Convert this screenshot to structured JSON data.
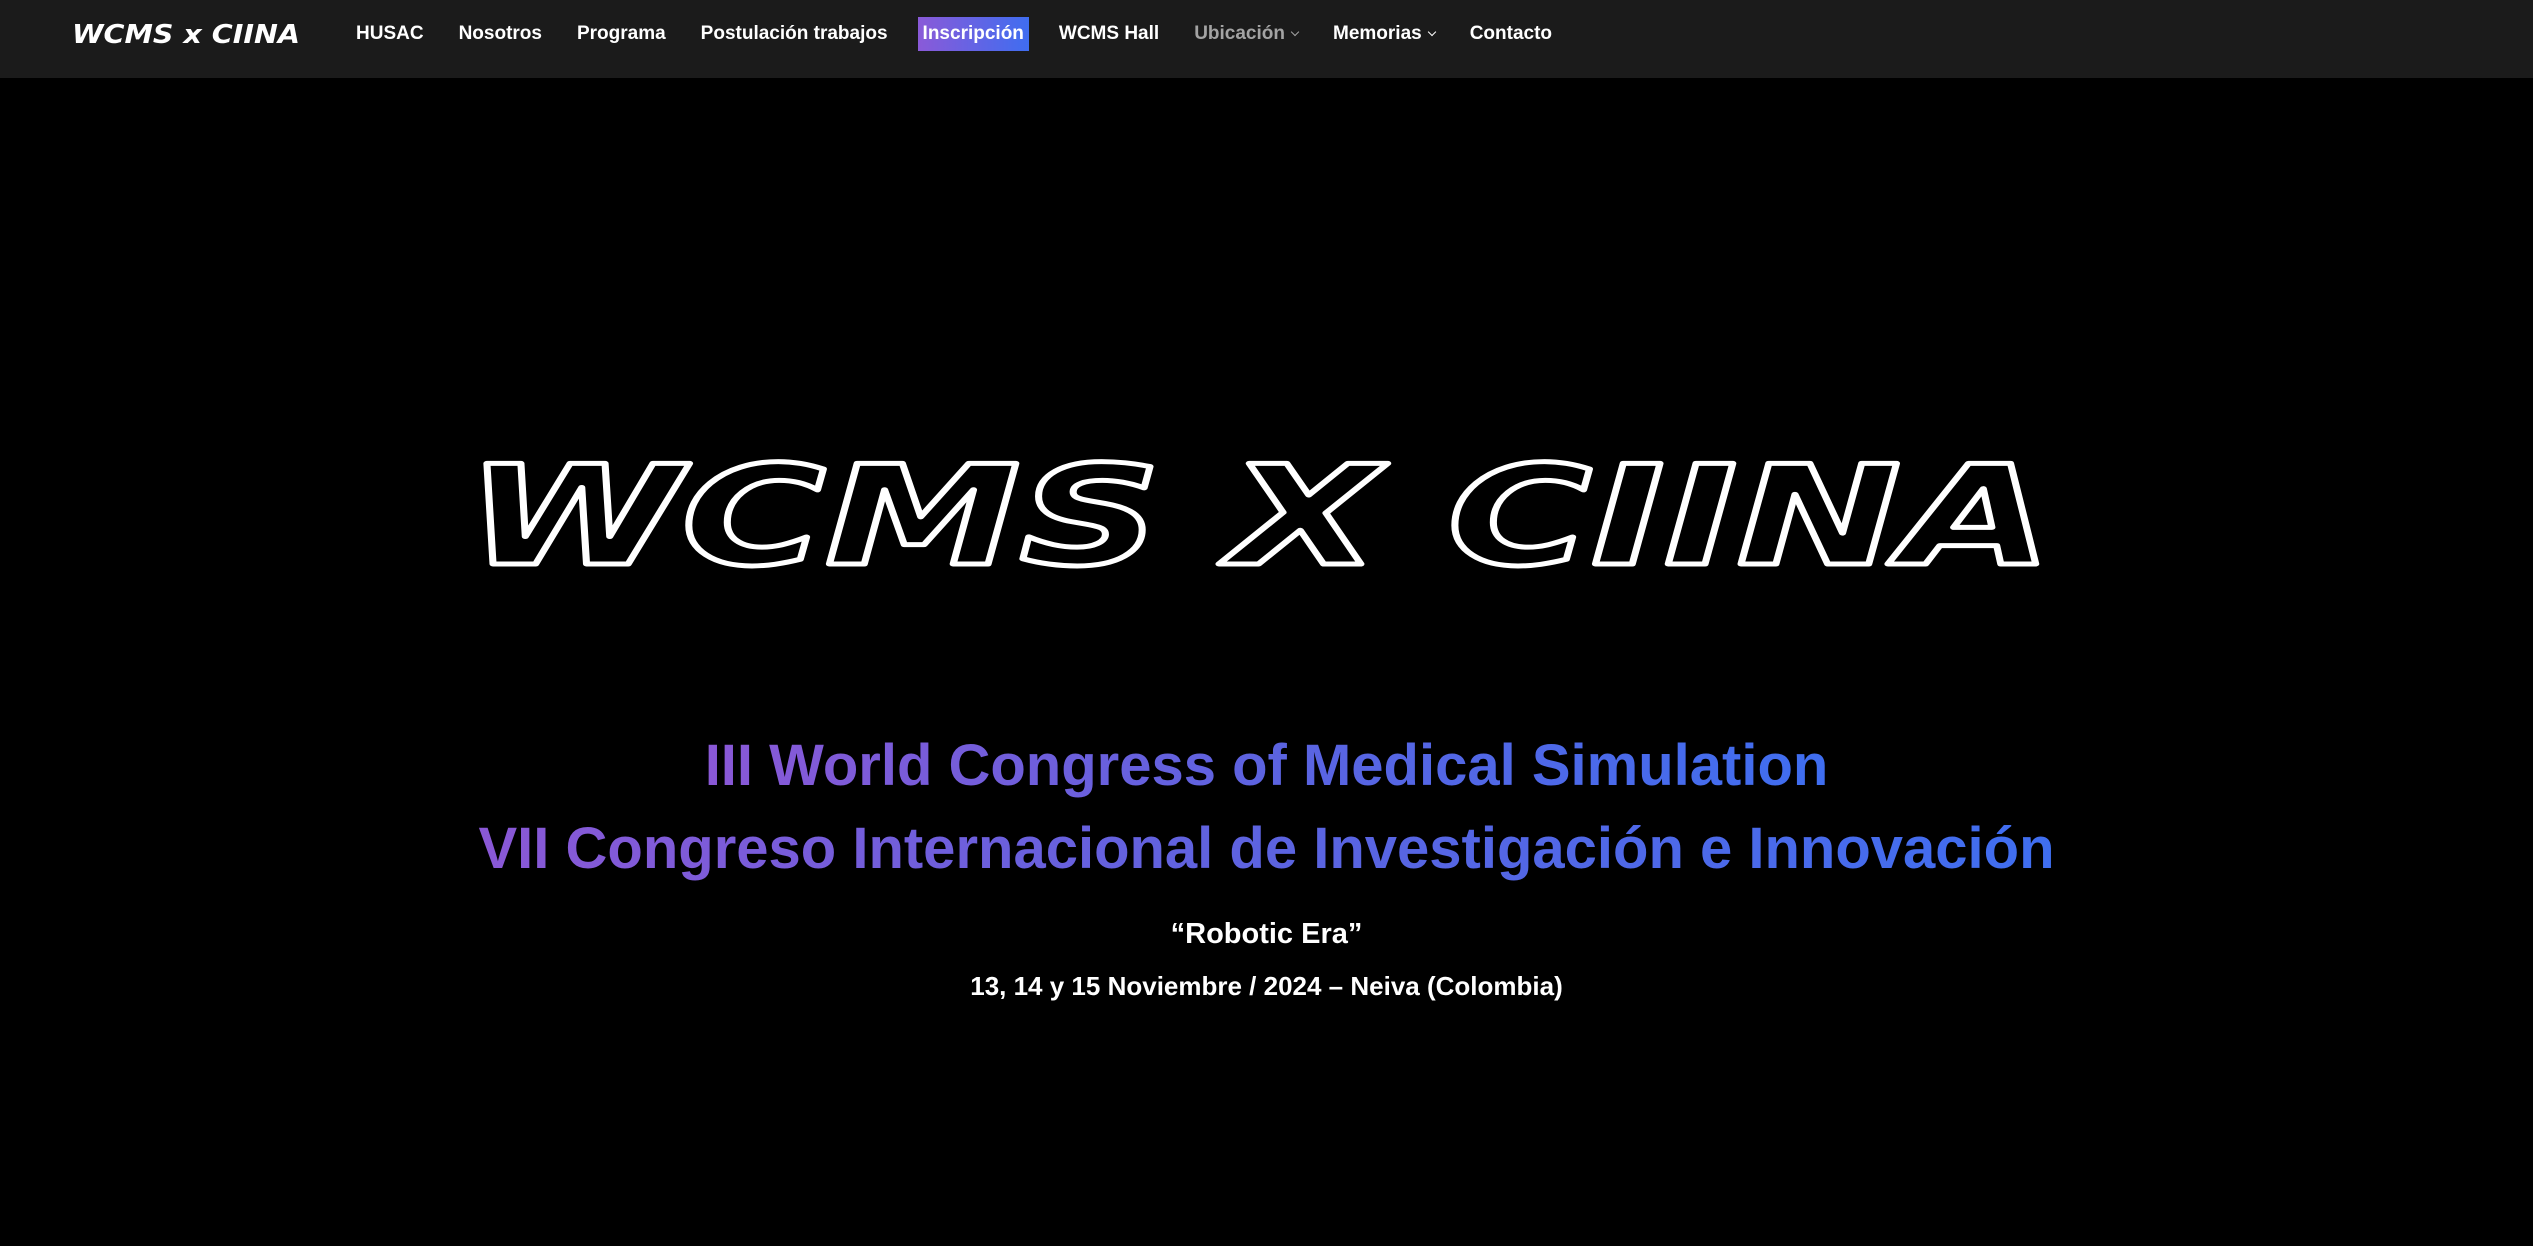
{
  "brand": {
    "logo_text": "WCMS x CIINA"
  },
  "nav": {
    "items": [
      {
        "label": "HUSAC"
      },
      {
        "label": "Nosotros"
      },
      {
        "label": "Programa"
      },
      {
        "label": "Postulación trabajos"
      },
      {
        "label": "Inscripción"
      },
      {
        "label": "WCMS Hall"
      },
      {
        "label": "Ubicación"
      },
      {
        "label": "Memorias"
      },
      {
        "label": "Contacto"
      }
    ]
  },
  "hero": {
    "logo_text": "WCMS X CIINA",
    "title_line1": "III World Congress of Medical Simulation",
    "title_line2": "VII Congreso Internacional de Investigación e Innovación",
    "subtitle": "“Robotic Era”",
    "dates": "13, 14 y 15 Noviembre / 2024 – Neiva (Colombia)"
  },
  "colors": {
    "background": "#000000",
    "navbar": "#1b1b1b",
    "gradient_start": "#8a58d6",
    "gradient_end": "#3f6ef0",
    "muted_nav": "#a3a3a3"
  },
  "icons": {
    "dropdown": "chevron-down-icon"
  }
}
